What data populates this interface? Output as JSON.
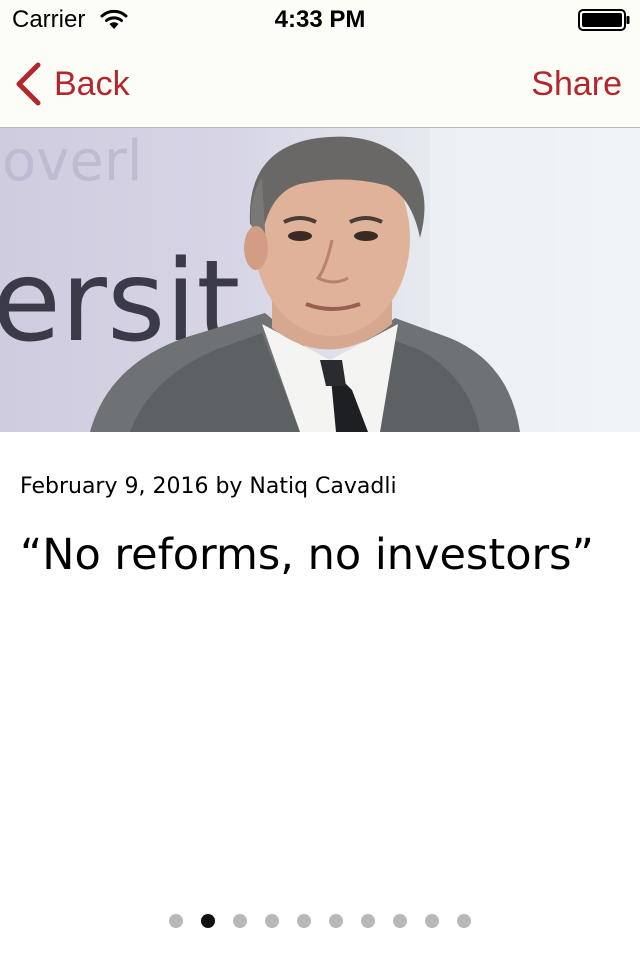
{
  "status_bar": {
    "carrier": "Carrier",
    "time": "4:33 PM",
    "icons": [
      "wifi-icon",
      "battery-icon"
    ]
  },
  "nav": {
    "back_label": "Back",
    "share_label": "Share",
    "accent_color": "#b3262b",
    "icons": [
      "chevron-left-icon"
    ]
  },
  "hero": {
    "backdrop_text_top": "overl",
    "backdrop_text_main": "ersit"
  },
  "article": {
    "byline": "February 9, 2016 by Natiq Cavadli",
    "headline": "“No reforms, no investors”"
  },
  "pagination": {
    "total_pages": 10,
    "current_page": 2
  }
}
